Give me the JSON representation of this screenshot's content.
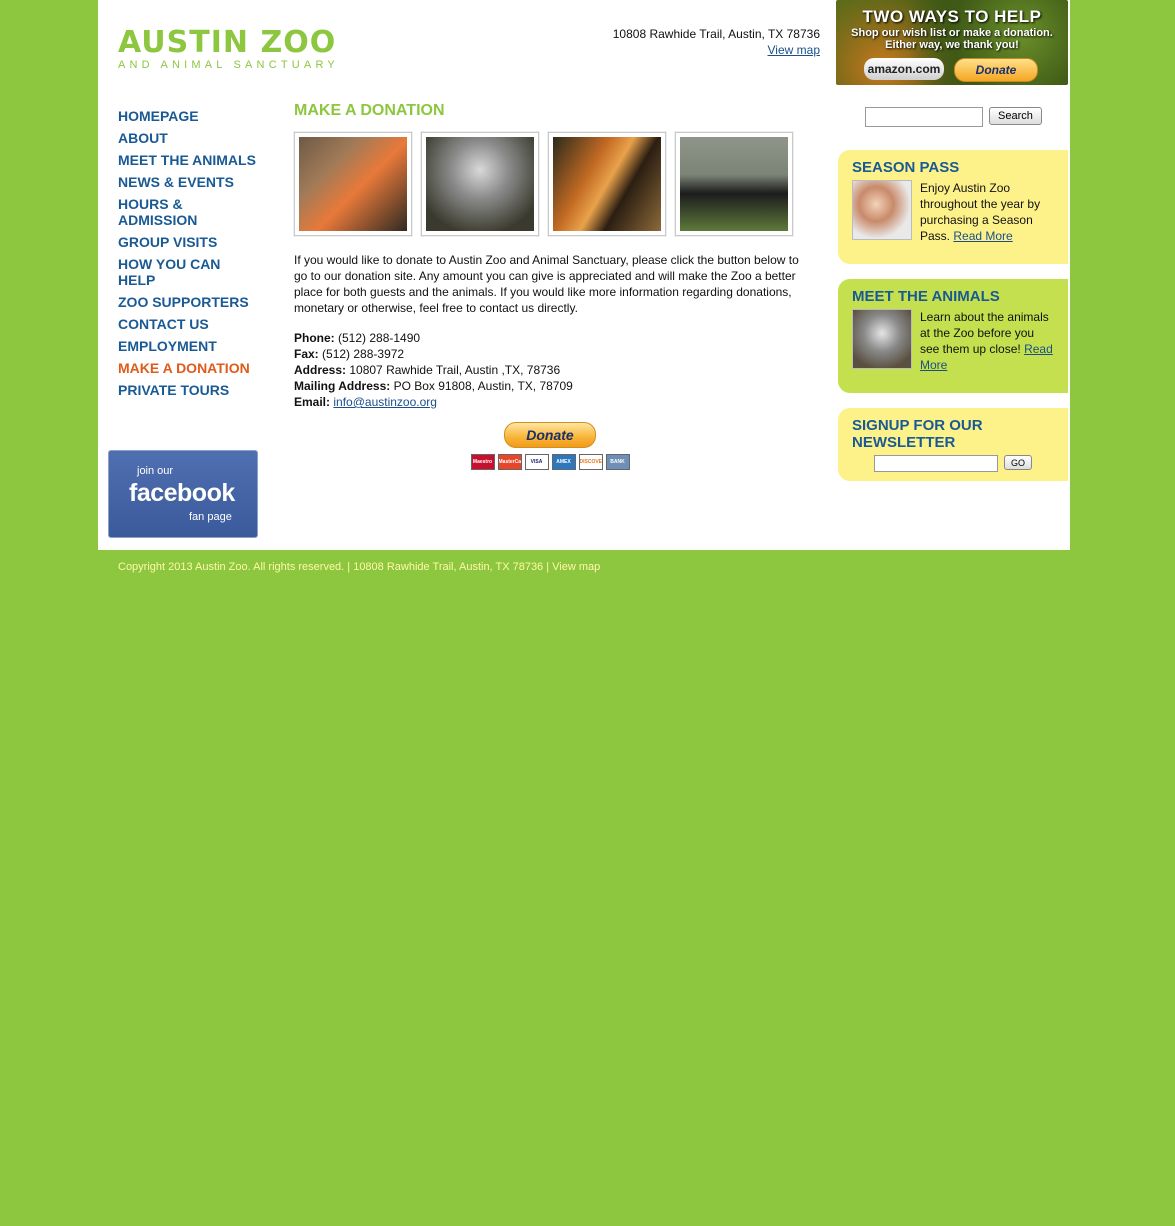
{
  "header": {
    "logo_main": "AUSTIN ZOO",
    "logo_sub": "AND ANIMAL SANCTUARY",
    "address": "10808 Rawhide Trail, Austin, TX 78736",
    "view_map": "View map"
  },
  "help_banner": {
    "title": "TWO WAYS TO HELP",
    "line1": "Shop our wish list or make a donation.",
    "line2": "Either way, we thank you!",
    "amazon_label": "amazon.com",
    "donate_label": "Donate"
  },
  "nav": {
    "items": [
      {
        "label": "HOMEPAGE"
      },
      {
        "label": "ABOUT"
      },
      {
        "label": "MEET THE ANIMALS"
      },
      {
        "label": "NEWS & EVENTS"
      },
      {
        "label": "HOURS & ADMISSION"
      },
      {
        "label": "GROUP VISITS"
      },
      {
        "label": "HOW YOU CAN HELP"
      },
      {
        "label": "ZOO SUPPORTERS"
      },
      {
        "label": "CONTACT US"
      },
      {
        "label": "EMPLOYMENT"
      },
      {
        "label": "MAKE A DONATION"
      },
      {
        "label": "PRIVATE TOURS"
      }
    ],
    "active_color": "#e05a1a",
    "color": "#1a5a94"
  },
  "facebook": {
    "join": "join our",
    "word": "facebook",
    "fan": "fan page"
  },
  "main": {
    "title": "MAKE A DONATION",
    "intro": "If you would like to donate to Austin Zoo and Animal Sanctuary, please click the button below to go to our donation site. Any amount you can give is appreciated and will make the Zoo a better place for both guests and the animals. If you would like more information regarding donations, monetary or otherwise, feel free to contact us directly.",
    "contact": {
      "phone_label": "Phone:",
      "phone": "(512) 288-1490",
      "fax_label": "Fax:",
      "fax": "(512) 288-3972",
      "address_label": "Address:",
      "address": "10807 Rawhide Trail, Austin ,TX, 78736",
      "mailing_label": "Mailing Address:",
      "mailing": "PO Box 91808, Austin, TX, 78709",
      "email_label": "Email:",
      "email": "info@austinzoo.org"
    },
    "donate_button": "Donate",
    "cards": [
      "Maestro",
      "MasterCard",
      "VISA",
      "AMEX",
      "DISCOVER",
      "BANK"
    ]
  },
  "sidebar": {
    "search_button": "Search",
    "season_pass": {
      "title": "SEASON PASS",
      "text": "Enjoy Austin Zoo throughout the year by purchasing a Season Pass.",
      "link": "Read More"
    },
    "meet_animals": {
      "title": "MEET THE ANIMALS",
      "text": "Learn about the animals at the Zoo before you see them up close!",
      "link": "Read More"
    },
    "newsletter": {
      "title": "SIGNUP FOR OUR NEWSLETTER",
      "go": "GO"
    }
  },
  "footer": {
    "text": "Copyright 2013 Austin Zoo. All rights reserved. | 10808 Rawhide Trail, Austin, TX 78736 | View map"
  }
}
